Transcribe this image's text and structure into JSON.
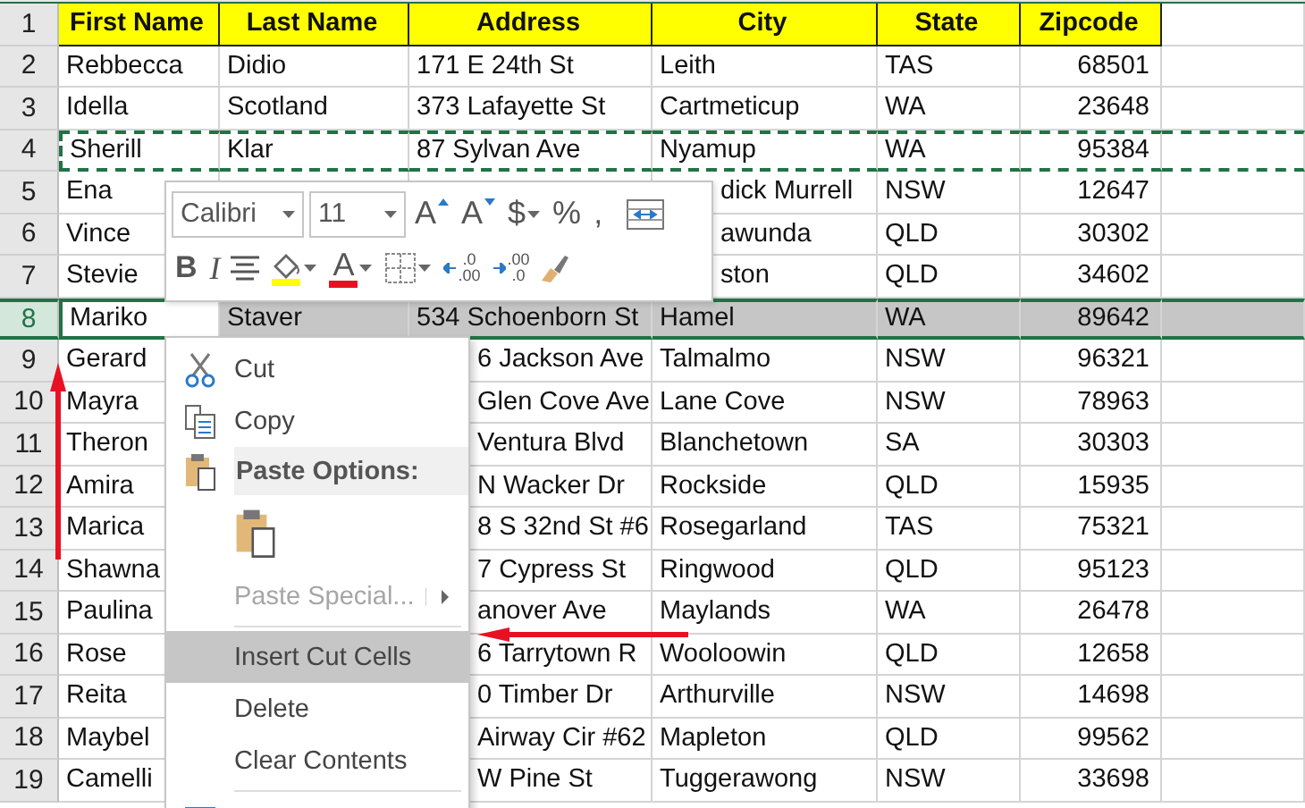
{
  "sheet": {
    "header": {
      "number": "1",
      "cells": [
        "First Name",
        "Last Name",
        "Address",
        "City",
        "State",
        "Zipcode"
      ]
    },
    "rows": [
      {
        "number": "2",
        "selected": false,
        "cut": false,
        "cells": [
          "Rebbecca",
          "Didio",
          "171 E 24th St",
          "Leith",
          "TAS",
          "68501"
        ]
      },
      {
        "number": "3",
        "selected": false,
        "cut": false,
        "cells": [
          "Idella",
          "Scotland",
          "373 Lafayette St",
          "Cartmeticup",
          "WA",
          "23648"
        ]
      },
      {
        "number": "4",
        "selected": false,
        "cut": true,
        "cells": [
          "Sherill",
          "Klar",
          "87 Sylvan Ave",
          "Nyamup",
          "WA",
          "95384"
        ]
      },
      {
        "number": "5",
        "selected": false,
        "cut": false,
        "cells": [
          "Ena",
          null,
          null,
          "dick Murrell",
          "NSW",
          "12647"
        ]
      },
      {
        "number": "6",
        "selected": false,
        "cut": false,
        "cells": [
          "Vince",
          null,
          null,
          "awunda",
          "QLD",
          "30302"
        ]
      },
      {
        "number": "7",
        "selected": false,
        "cut": false,
        "cells": [
          "Stevie",
          null,
          null,
          "ston",
          "QLD",
          "34602"
        ]
      },
      {
        "number": "8",
        "selected": true,
        "cut": false,
        "cells": [
          "Mariko",
          "Staver",
          "534 Schoenborn St",
          "Hamel",
          "WA",
          "89642"
        ]
      },
      {
        "number": "9",
        "selected": false,
        "cut": false,
        "cells": [
          "Gerard",
          null,
          "6 Jackson Ave",
          "Talmalmo",
          "NSW",
          "96321"
        ]
      },
      {
        "number": "10",
        "selected": false,
        "cut": false,
        "cells": [
          "Mayra",
          null,
          "Glen Cove Ave",
          "Lane Cove",
          "NSW",
          "78963"
        ]
      },
      {
        "number": "11",
        "selected": false,
        "cut": false,
        "cells": [
          "Theron",
          null,
          "Ventura Blvd",
          "Blanchetown",
          "SA",
          "30303"
        ]
      },
      {
        "number": "12",
        "selected": false,
        "cut": false,
        "cells": [
          "Amira",
          null,
          "N Wacker Dr",
          "Rockside",
          "QLD",
          "15935"
        ]
      },
      {
        "number": "13",
        "selected": false,
        "cut": false,
        "cells": [
          "Marica",
          null,
          "8 S 32nd St #6",
          "Rosegarland",
          "TAS",
          "75321"
        ]
      },
      {
        "number": "14",
        "selected": false,
        "cut": false,
        "cells": [
          "Shawna",
          null,
          "7 Cypress St",
          "Ringwood",
          "QLD",
          "95123"
        ]
      },
      {
        "number": "15",
        "selected": false,
        "cut": false,
        "cells": [
          "Paulina",
          null,
          "anover Ave",
          "Maylands",
          "WA",
          "26478"
        ]
      },
      {
        "number": "16",
        "selected": false,
        "cut": false,
        "cells": [
          "Rose",
          null,
          "6 Tarrytown R",
          "Wooloowin",
          "QLD",
          "12658"
        ]
      },
      {
        "number": "17",
        "selected": false,
        "cut": false,
        "cells": [
          "Reita",
          null,
          "0 Timber Dr",
          "Arthurville",
          "NSW",
          "14698"
        ]
      },
      {
        "number": "18",
        "selected": false,
        "cut": false,
        "cells": [
          "Maybel",
          null,
          "Airway Cir #62",
          "Mapleton",
          "QLD",
          "99562"
        ]
      },
      {
        "number": "19",
        "selected": false,
        "cut": false,
        "cells": [
          "Camelli",
          null,
          "W Pine St",
          "Tuggerawong",
          "NSW",
          "33698"
        ]
      }
    ]
  },
  "mini_toolbar": {
    "font": "Calibri",
    "size": "11",
    "row_1": [
      {
        "kind": "grow",
        "label": "A"
      },
      {
        "kind": "shrink",
        "label": "A"
      },
      {
        "kind": "currency",
        "label": "$"
      },
      {
        "kind": "plain",
        "label": "%"
      },
      {
        "kind": "plain",
        "label": ","
      },
      {
        "kind": "wrap"
      }
    ],
    "row_2": [
      {
        "kind": "bold",
        "label": "B"
      },
      {
        "kind": "italic",
        "label": "I"
      },
      {
        "kind": "align"
      },
      {
        "kind": "fill",
        "color": "#ffff00"
      },
      {
        "kind": "font-color",
        "label": "A",
        "color": "#e81123"
      },
      {
        "kind": "borders"
      },
      {
        "kind": "decimal-more",
        "top": ".0",
        "bottom": ".00"
      },
      {
        "kind": "decimal-less",
        "top": ".00",
        "bottom": ".0"
      },
      {
        "kind": "brush"
      }
    ]
  },
  "context_menu": [
    {
      "kind": "item",
      "label": "Cut",
      "disabled": false,
      "selected": false
    },
    {
      "kind": "item",
      "label": "Copy",
      "disabled": false,
      "selected": false
    },
    {
      "kind": "header",
      "label": "Paste Options:"
    },
    {
      "kind": "paste-icon"
    },
    {
      "kind": "item",
      "label": "Paste Special...",
      "disabled": true,
      "selected": false,
      "submenu": true
    },
    {
      "kind": "separator"
    },
    {
      "kind": "item",
      "label": "Insert Cut Cells",
      "disabled": false,
      "selected": true
    },
    {
      "kind": "item",
      "label": "Delete",
      "disabled": false,
      "selected": false
    },
    {
      "kind": "item",
      "label": "Clear Contents",
      "disabled": false,
      "selected": false
    },
    {
      "kind": "separator"
    },
    {
      "kind": "cut-off"
    }
  ]
}
